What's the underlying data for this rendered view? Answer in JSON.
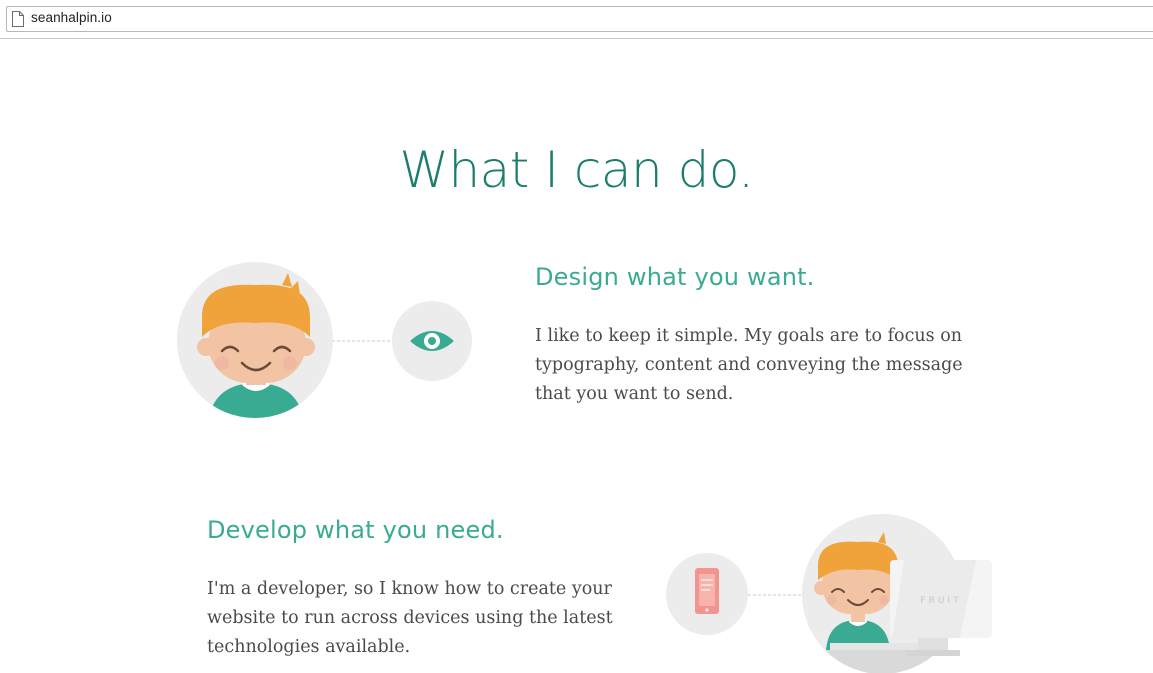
{
  "browser": {
    "url": "seanhalpin.io",
    "icons": {
      "page": "page-icon"
    }
  },
  "main": {
    "heading": "What I can do.",
    "sections": [
      {
        "title": "Design what you want.",
        "lines": [
          "I like to keep it simple. My goals are to focus on",
          "typography, content and conveying the message",
          "that you want to send."
        ],
        "icon": "eye-icon"
      },
      {
        "title": "Develop what you need.",
        "lines": [
          "I'm a developer, so I know how to create your",
          "website to run across devices using the latest",
          "technologies available."
        ],
        "icon": "phone-icon",
        "monitor_label": "FRUIT"
      }
    ]
  },
  "colors": {
    "heading": "#1b7d6b",
    "accent": "#3aab93",
    "body_text": "#4a4a4a",
    "circle_bg": "#ececec",
    "hair": "#f0a33a",
    "shirt": "#3aab93",
    "phone": "#f3948e"
  }
}
